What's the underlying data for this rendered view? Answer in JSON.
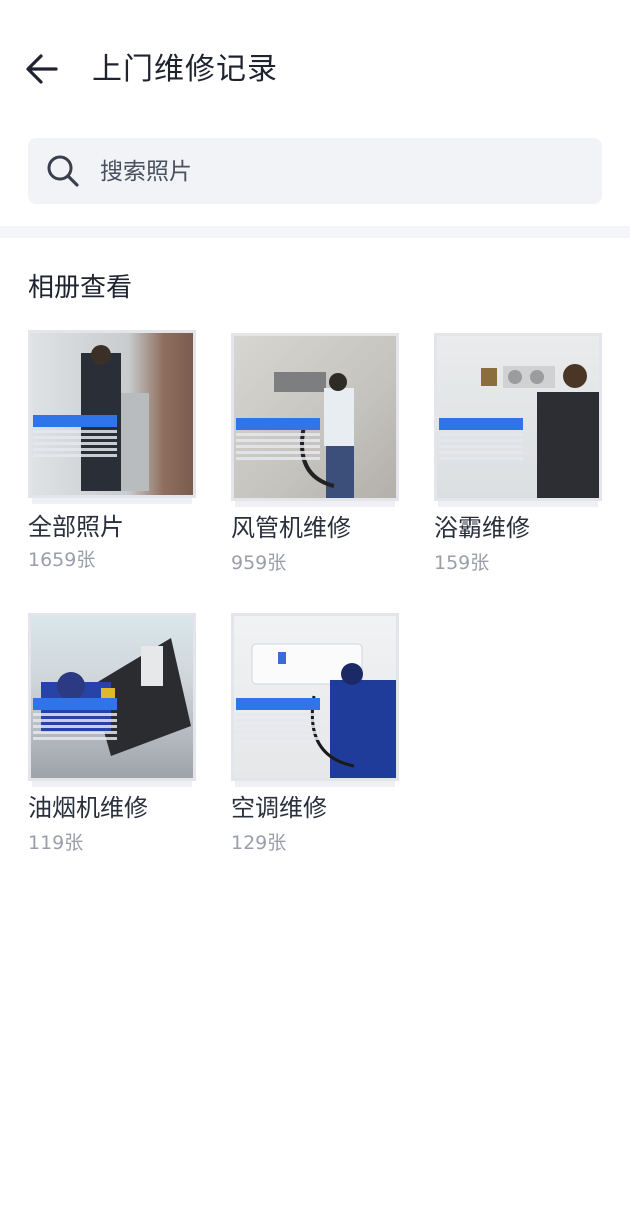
{
  "header": {
    "title": "上门维修记录"
  },
  "search": {
    "placeholder": "搜索照片"
  },
  "section": {
    "title": "相册查看"
  },
  "albums": [
    {
      "name": "全部照片",
      "count": "1659张"
    },
    {
      "name": "风管机维修",
      "count": "959张"
    },
    {
      "name": "浴霸维修",
      "count": "159张"
    },
    {
      "name": "油烟机维修",
      "count": "119张"
    },
    {
      "name": "空调维修",
      "count": "129张"
    }
  ],
  "colors": {
    "accent": "#2f74e8",
    "text": "#1f2330",
    "muted": "#9a9ea8",
    "search_bg": "#f2f3f6"
  },
  "icons": {
    "back": "arrow-left-icon",
    "search": "search-icon"
  }
}
